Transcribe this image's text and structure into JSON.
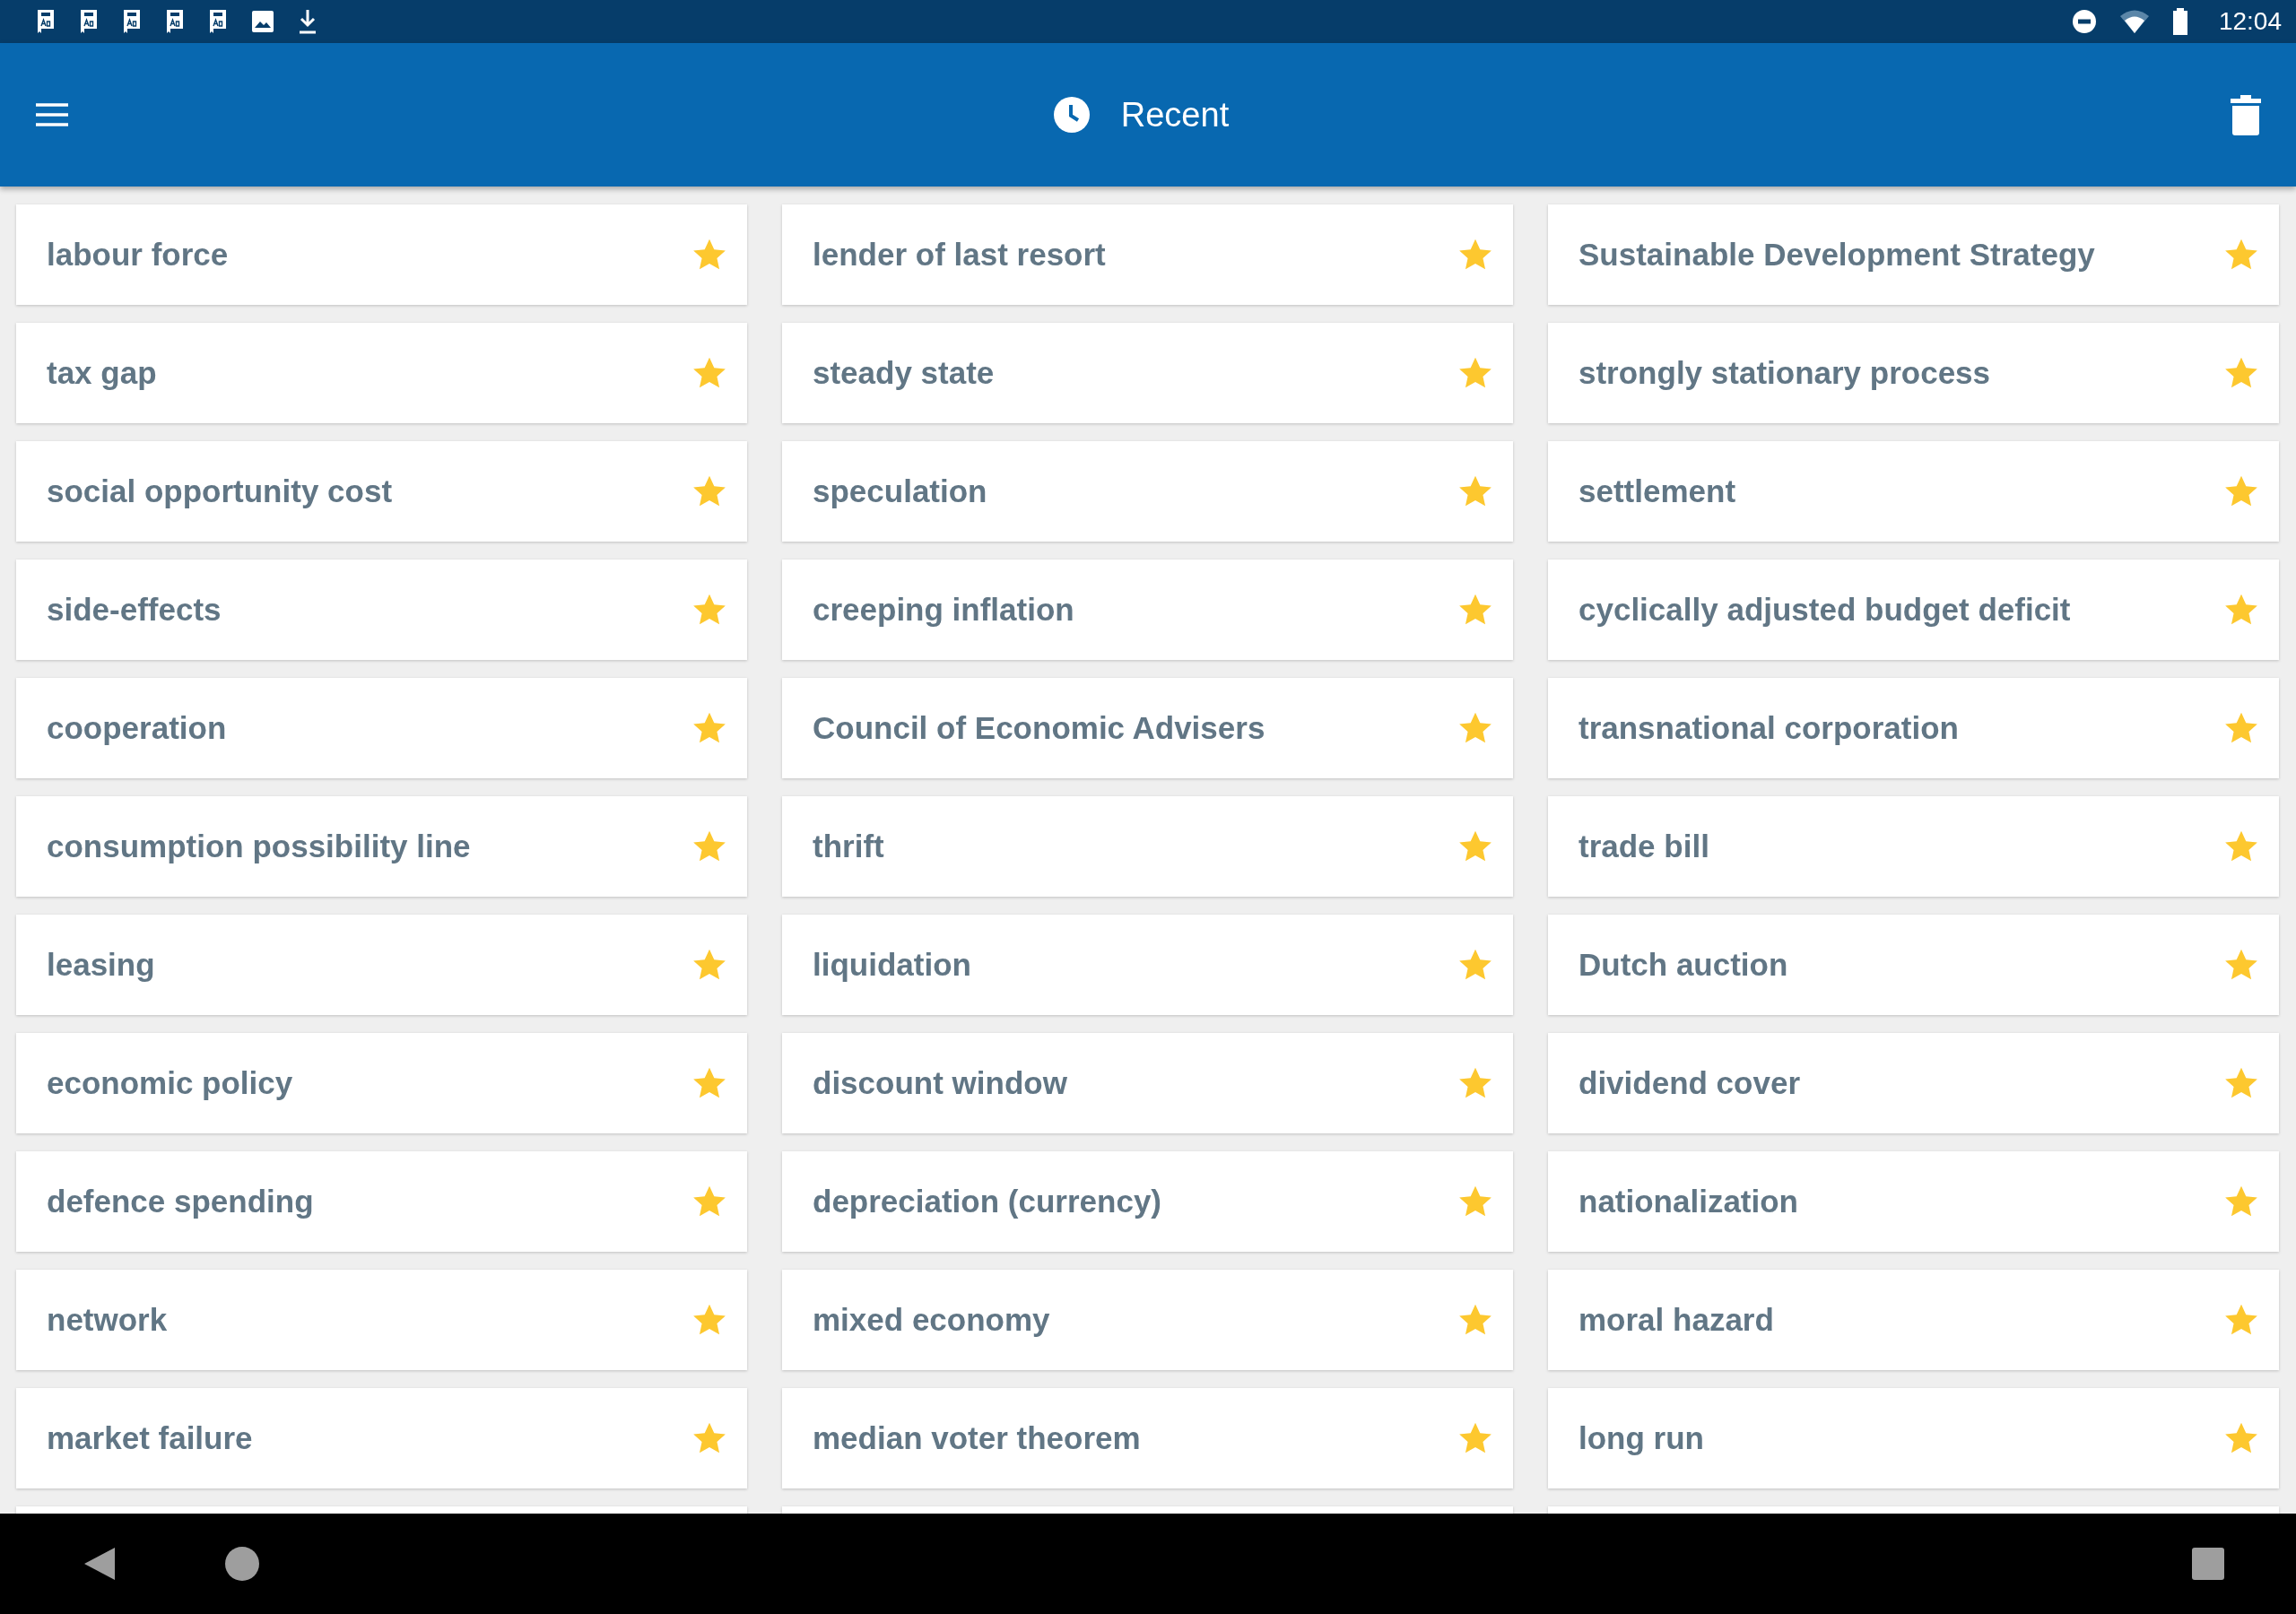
{
  "status_bar": {
    "notifications": [
      {
        "kind": "dictionary"
      },
      {
        "kind": "dictionary"
      },
      {
        "kind": "dictionary"
      },
      {
        "kind": "dictionary"
      },
      {
        "kind": "dictionary"
      },
      {
        "kind": "image"
      },
      {
        "kind": "download"
      }
    ],
    "time": "12:04"
  },
  "app_bar": {
    "title": "Recent"
  },
  "items": [
    {
      "term": "labour force",
      "starred": true
    },
    {
      "term": "lender of last resort",
      "starred": true
    },
    {
      "term": "Sustainable Development Strategy",
      "starred": true
    },
    {
      "term": "tax gap",
      "starred": true
    },
    {
      "term": "steady state",
      "starred": true
    },
    {
      "term": "strongly stationary process",
      "starred": true
    },
    {
      "term": "social opportunity cost",
      "starred": true
    },
    {
      "term": "speculation",
      "starred": true
    },
    {
      "term": "settlement",
      "starred": true
    },
    {
      "term": "side-effects",
      "starred": true
    },
    {
      "term": "creeping inflation",
      "starred": true
    },
    {
      "term": "cyclically adjusted budget deficit",
      "starred": true
    },
    {
      "term": "cooperation",
      "starred": true
    },
    {
      "term": "Council of Economic Advisers",
      "starred": true
    },
    {
      "term": "transnational corporation",
      "starred": true
    },
    {
      "term": "consumption possibility line",
      "starred": true
    },
    {
      "term": "thrift",
      "starred": true
    },
    {
      "term": "trade bill",
      "starred": true
    },
    {
      "term": "leasing",
      "starred": true
    },
    {
      "term": "liquidation",
      "starred": true
    },
    {
      "term": "Dutch auction",
      "starred": true
    },
    {
      "term": "economic policy",
      "starred": true
    },
    {
      "term": "discount window",
      "starred": true
    },
    {
      "term": "dividend cover",
      "starred": true
    },
    {
      "term": "defence spending",
      "starred": true
    },
    {
      "term": "depreciation (currency)",
      "starred": true
    },
    {
      "term": "nationalization",
      "starred": true
    },
    {
      "term": "network",
      "starred": true
    },
    {
      "term": "mixed economy",
      "starred": true
    },
    {
      "term": "moral hazard",
      "starred": true
    },
    {
      "term": "market failure",
      "starred": true
    },
    {
      "term": "median voter theorem",
      "starred": true
    },
    {
      "term": "long run",
      "starred": true
    }
  ]
}
